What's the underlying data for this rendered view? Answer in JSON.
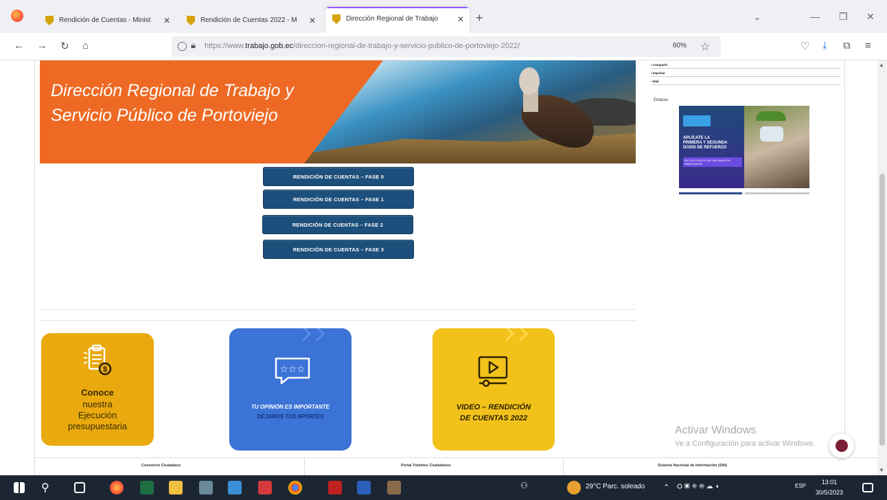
{
  "browser": {
    "tabs": [
      {
        "title": "Rendición de Cuentas - Minist",
        "active": false
      },
      {
        "title": "Rendición de Cuentas 2022 - M",
        "active": false
      },
      {
        "title": "Dirección Regional de Trabajo",
        "active": true
      }
    ],
    "url_prefix": "https://www.",
    "url_domain": "trabajo.gob.ec",
    "url_path": "/direccion-regional-de-trabajo-y-servicio-publico-de-portoviejo-2022/",
    "zoom": "60%"
  },
  "hero": {
    "title_line1": "Dirección Regional de Trabajo y",
    "title_line2": "Servicio Público de Portoviejo"
  },
  "buttons": [
    "RENDICIÓN DE CUENTAS – FASE 0",
    "RENDICIÓN DE CUENTAS – FASE 1",
    "RENDICIÓN DE CUENTAS – FASE 2",
    "RENDICIÓN DE CUENTAS – FASE 3"
  ],
  "cards": {
    "ejecucion": {
      "line1": "Conoce",
      "line2": "nuestra",
      "line3": "Ejecución",
      "line4": "presupuestaria"
    },
    "opinion": {
      "line1": "TU OPINIÓN ES IMPORTANTE",
      "line2": "DÉJANOS TUS APORTES"
    },
    "video": {
      "line1": "VIDEO – RENDICIÓN",
      "line2": "DE CUENTAS 2022"
    }
  },
  "sidebar": {
    "rows": [
      "Compartir",
      "Imprimir",
      "Mail"
    ],
    "label": "Enlaces",
    "promo_line1": "APLÍCATE LA",
    "promo_line2": "PRIMERA Y SEGUNDA",
    "promo_line3": "DOSIS DE REFUERZO",
    "promo_sub": "EN LOS PUNTOS DE VACUNACIÓN HABILITADOS"
  },
  "footer": [
    "Consorcio Ciudadano",
    "Portal Trámites Ciudadanos",
    "Sistema Nacional de Información (SNI)"
  ],
  "watermark": {
    "line1": "Activar Windows",
    "line2": "Ve a Configuración para activar Windows."
  },
  "taskbar": {
    "weather": "29°C  Parc. soleado",
    "lang": "ESP",
    "time": "13:01",
    "date": "30/5/2023"
  },
  "colors": {
    "orange": "#ee6a24",
    "button_blue": "#1d4f7c",
    "card_yellow": "#e9a90f",
    "card_blue": "#3b73d6",
    "card_gold": "#f2c21b"
  }
}
